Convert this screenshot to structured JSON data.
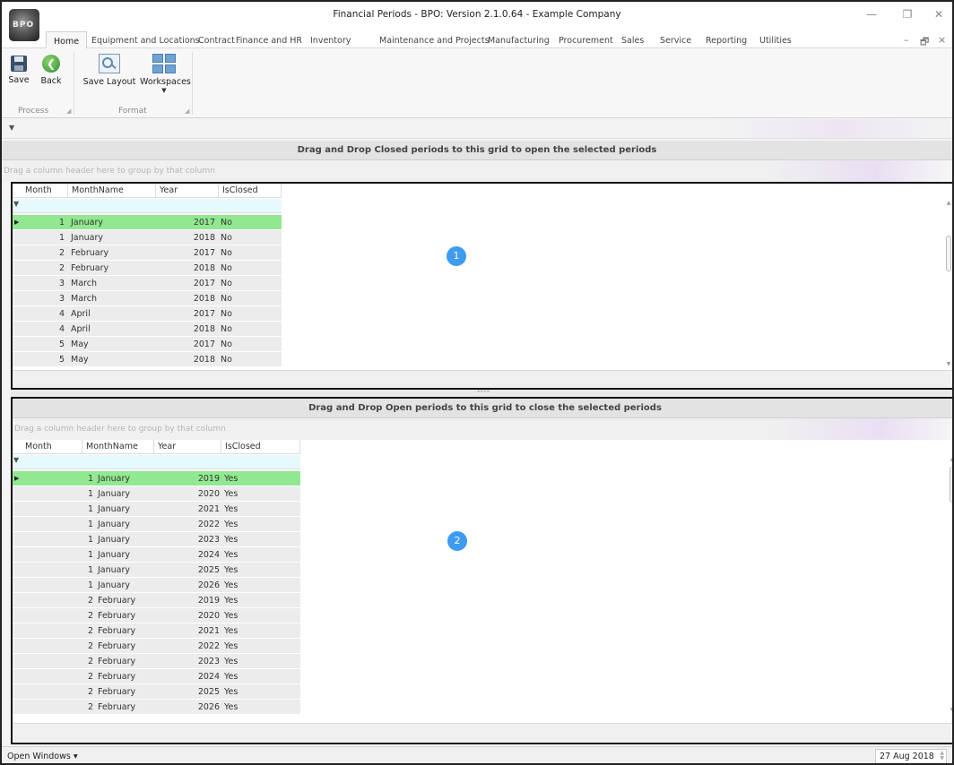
{
  "window": {
    "title": "Financial Periods - BPO: Version 2.1.0.64 - Example Company",
    "logo_text": "BPO",
    "minimize_glyph": "—",
    "restore_glyph": "❐",
    "close_glyph": "✕",
    "mdi_minimize_glyph": "–",
    "mdi_restore_glyph": "🗗",
    "mdi_close_glyph": "×"
  },
  "menu_tabs": [
    "Home",
    "Equipment and Locations",
    "Contract",
    "Finance and HR",
    "Inventory",
    "Maintenance and Projects",
    "Manufacturing",
    "Procurement",
    "Sales",
    "Service",
    "Reporting",
    "Utilities"
  ],
  "ribbon": {
    "save_label": "Save",
    "back_label": "Back",
    "save_layout_label": "Save Layout",
    "workspaces_label": "Workspaces",
    "group_process": "Process",
    "group_format": "Format"
  },
  "icons": {
    "save": "floppy-disk-icon",
    "back": "back-arrow-icon",
    "save_layout": "layout-icon",
    "workspaces": "workspaces-icon",
    "filter": "filter-icon",
    "row_indicator": "row-indicator-icon"
  },
  "colors": {
    "selected_row": "#92e890",
    "filter_row": "#e6fafd",
    "badge": "#3e9bf0",
    "panel_border": "#111111"
  },
  "closed_grid": {
    "caption": "Drag and Drop Closed periods to this grid to open the selected periods",
    "group_hint": "Drag a column header here to group by that column",
    "badge": "1",
    "columns": [
      "Month",
      "MonthName",
      "Year",
      "IsClosed"
    ],
    "rows": [
      [
        "1",
        "January",
        "2017",
        "No"
      ],
      [
        "1",
        "January",
        "2018",
        "No"
      ],
      [
        "2",
        "February",
        "2017",
        "No"
      ],
      [
        "2",
        "February",
        "2018",
        "No"
      ],
      [
        "3",
        "March",
        "2017",
        "No"
      ],
      [
        "3",
        "March",
        "2018",
        "No"
      ],
      [
        "4",
        "April",
        "2017",
        "No"
      ],
      [
        "4",
        "April",
        "2018",
        "No"
      ],
      [
        "5",
        "May",
        "2017",
        "No"
      ],
      [
        "5",
        "May",
        "2018",
        "No"
      ]
    ]
  },
  "open_grid": {
    "caption": "Drag and Drop Open periods to this grid to close the selected periods",
    "group_hint": "Drag a column header here to group by that column",
    "badge": "2",
    "columns": [
      "Month",
      "MonthName",
      "Year",
      "IsClosed"
    ],
    "rows": [
      [
        "1",
        "January",
        "2019",
        "Yes"
      ],
      [
        "1",
        "January",
        "2020",
        "Yes"
      ],
      [
        "1",
        "January",
        "2021",
        "Yes"
      ],
      [
        "1",
        "January",
        "2022",
        "Yes"
      ],
      [
        "1",
        "January",
        "2023",
        "Yes"
      ],
      [
        "1",
        "January",
        "2024",
        "Yes"
      ],
      [
        "1",
        "January",
        "2025",
        "Yes"
      ],
      [
        "1",
        "January",
        "2026",
        "Yes"
      ],
      [
        "2",
        "February",
        "2019",
        "Yes"
      ],
      [
        "2",
        "February",
        "2020",
        "Yes"
      ],
      [
        "2",
        "February",
        "2021",
        "Yes"
      ],
      [
        "2",
        "February",
        "2022",
        "Yes"
      ],
      [
        "2",
        "February",
        "2023",
        "Yes"
      ],
      [
        "2",
        "February",
        "2024",
        "Yes"
      ],
      [
        "2",
        "February",
        "2025",
        "Yes"
      ],
      [
        "2",
        "February",
        "2026",
        "Yes"
      ]
    ]
  },
  "statusbar": {
    "open_windows": "Open Windows ▾",
    "date": "27 Aug 2018"
  }
}
